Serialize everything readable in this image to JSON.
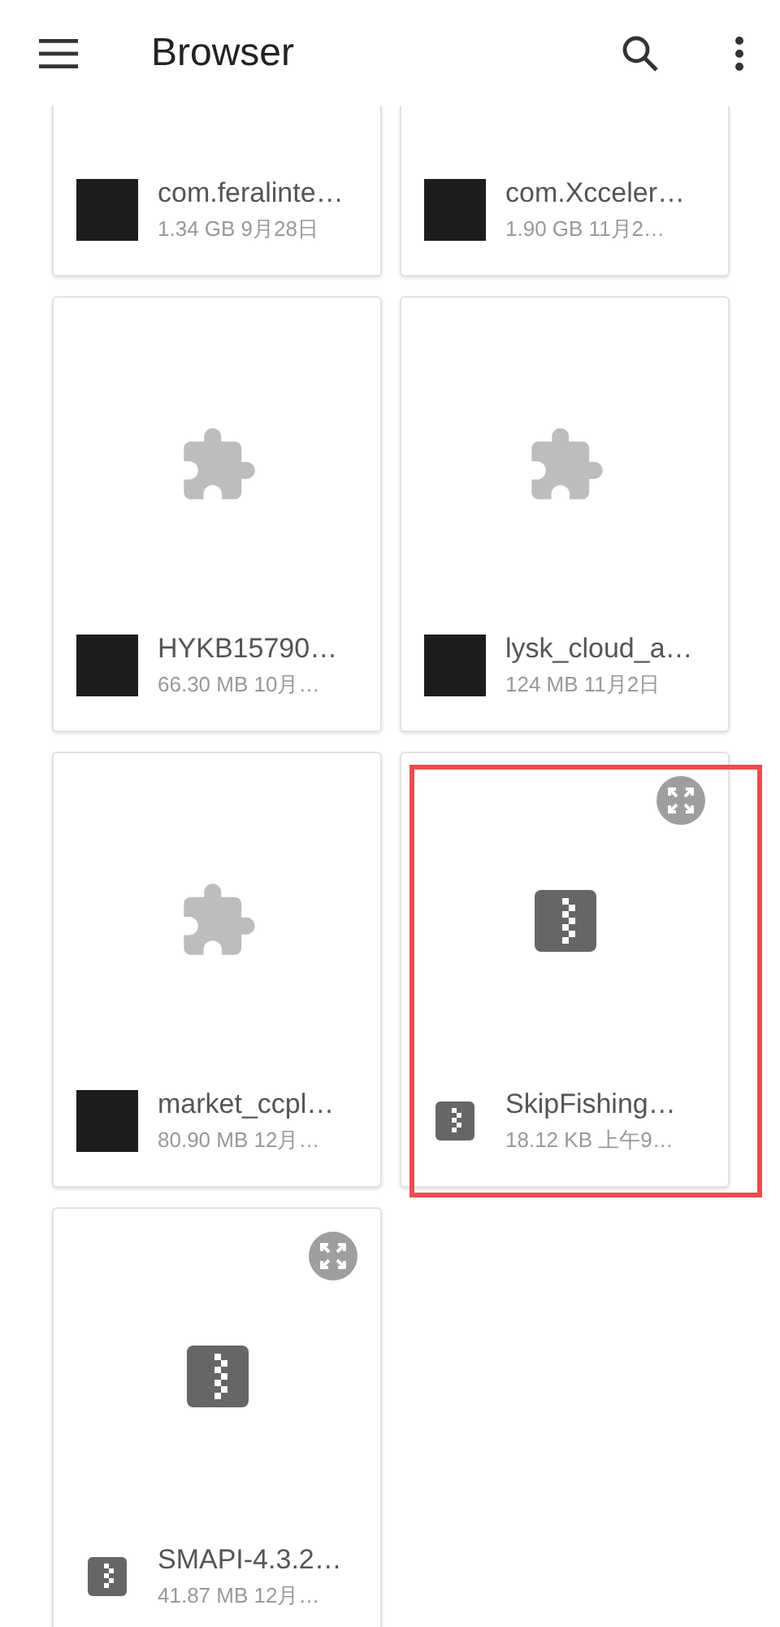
{
  "app_bar": {
    "title": "Browser"
  },
  "files": [
    {
      "kind": "apk",
      "name": "com.feralinte…",
      "meta": "1.34 GB 9月28日",
      "highlighted": false,
      "cut_off_top": true
    },
    {
      "kind": "apk",
      "name": "com.Xcceler…",
      "meta": "1.90 GB 11月2…",
      "highlighted": false,
      "cut_off_top": true
    },
    {
      "kind": "apk",
      "name": "HYKB15790…",
      "meta": "66.30 MB 10月…",
      "highlighted": false
    },
    {
      "kind": "apk",
      "name": "lysk_cloud_a…",
      "meta": "124 MB 11月2日",
      "highlighted": false
    },
    {
      "kind": "apk",
      "name": "market_ccpl…",
      "meta": "80.90 MB 12月…",
      "highlighted": false
    },
    {
      "kind": "zip",
      "name": "SkipFishing…",
      "meta": "18.12 KB 上午9…",
      "highlighted": true
    },
    {
      "kind": "zip",
      "name": "SMAPI-4.3.2…",
      "meta": "41.87 MB 12月…",
      "highlighted": false
    }
  ]
}
